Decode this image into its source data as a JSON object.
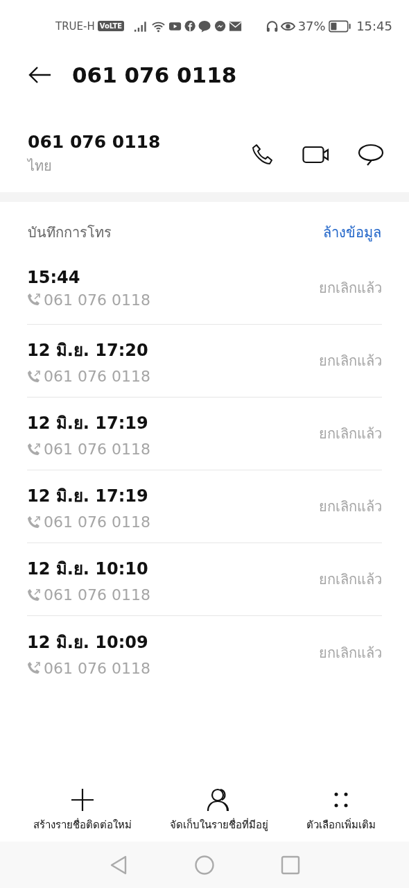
{
  "status_bar": {
    "carrier": "TRUE-H",
    "volte": "VoLTE",
    "battery": "37%",
    "time": "15:45"
  },
  "header": {
    "title": "061 076 0118"
  },
  "contact": {
    "number": "061 076 0118",
    "region": "ไทย"
  },
  "call_log": {
    "title": "บันทึกการโทร",
    "clear": "ล้างข้อมูล",
    "entries": [
      {
        "time": "15:44",
        "number": "061 076 0118",
        "status": "ยกเลิกแล้ว"
      },
      {
        "time": "12 มิ.ย. 17:20",
        "number": "061 076 0118",
        "status": "ยกเลิกแล้ว"
      },
      {
        "time": "12 มิ.ย. 17:19",
        "number": "061 076 0118",
        "status": "ยกเลิกแล้ว"
      },
      {
        "time": "12 มิ.ย. 17:19",
        "number": "061 076 0118",
        "status": "ยกเลิกแล้ว"
      },
      {
        "time": "12 มิ.ย. 10:10",
        "number": "061 076 0118",
        "status": "ยกเลิกแล้ว"
      },
      {
        "time": "12 มิ.ย. 10:09",
        "number": "061 076 0118",
        "status": "ยกเลิกแล้ว"
      }
    ]
  },
  "bottom_actions": [
    {
      "kind": "add",
      "label": "สร้างรายชื่อติดต่อใหม่"
    },
    {
      "kind": "contact",
      "label": "จัดเก็บในรายชื่อที่มีอยู่"
    },
    {
      "kind": "more",
      "label": "ตัวเลือกเพิ่มเติม"
    }
  ]
}
